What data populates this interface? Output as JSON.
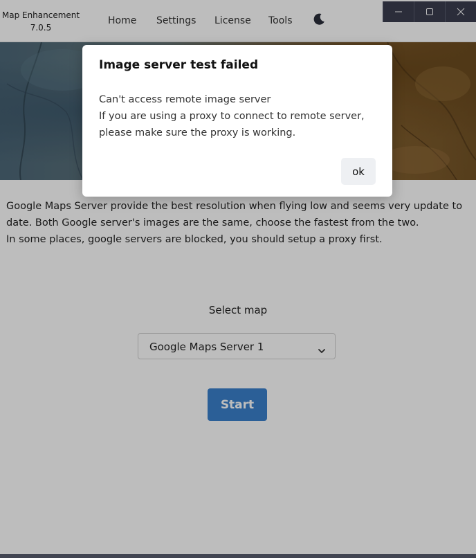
{
  "app": {
    "name": "Map Enhancement",
    "version": "7.0.5"
  },
  "nav": {
    "items": [
      {
        "label": "Home"
      },
      {
        "label": "Settings"
      },
      {
        "label": "License"
      },
      {
        "label": "Tools"
      }
    ],
    "theme_icon": "moon-icon"
  },
  "window_controls": {
    "icons": [
      "minimize-icon",
      "maximize-icon",
      "close-icon"
    ]
  },
  "content": {
    "line1": "Google Maps Server provide the best resolution when flying low and seems very update to",
    "line2": "date. Both Google server's images are the same, choose the fastest from the two.",
    "line3": "In some places, google servers are blocked, you should setup a proxy first."
  },
  "map_select": {
    "label": "Select map",
    "selected": "Google Maps Server 1"
  },
  "start_button": {
    "label": "Start"
  },
  "dialog": {
    "title": "Image server test failed",
    "line1": "Can't access remote image server",
    "line2": "If you are using a proxy to connect to remote server,",
    "line3": "please make sure the proxy is working.",
    "ok_label": "ok"
  },
  "colors": {
    "accent": "#3a80cc",
    "titlebar_controls": "#3a3d4f",
    "overlay": "rgba(0,0,0,0.26)"
  }
}
